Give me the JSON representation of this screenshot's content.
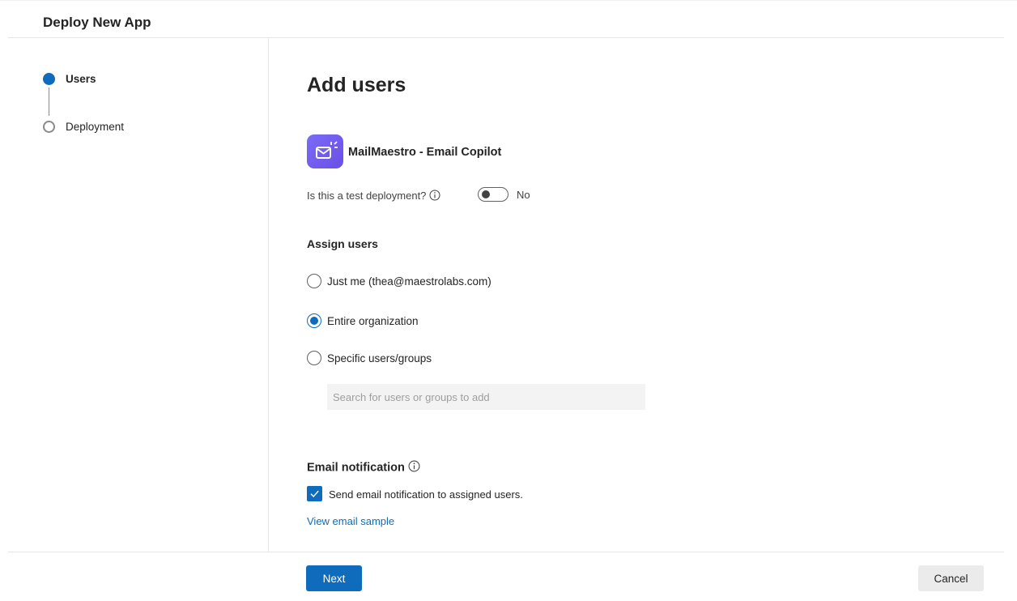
{
  "header": {
    "title": "Deploy New App"
  },
  "steps": [
    {
      "label": "Users",
      "state": "active"
    },
    {
      "label": "Deployment",
      "state": "inactive"
    }
  ],
  "main": {
    "title": "Add users",
    "app": {
      "name": "MailMaestro - Email Copilot",
      "icon": "mail-sparkle-icon",
      "icon_color": "#7b6cf6"
    },
    "test_deployment": {
      "label": "Is this a test deployment?",
      "toggle_value": "No",
      "enabled": false
    },
    "assign_users": {
      "title": "Assign users",
      "options": [
        {
          "label": "Just me (thea@maestrolabs.com)",
          "selected": false
        },
        {
          "label": "Entire organization",
          "selected": true
        },
        {
          "label": "Specific users/groups",
          "selected": false
        }
      ],
      "search_placeholder": "Search for users or groups to add"
    },
    "email_notification": {
      "title": "Email notification",
      "checkbox_label": "Send email notification to assigned users.",
      "checked": true,
      "link": "View email sample"
    }
  },
  "footer": {
    "next_label": "Next",
    "cancel_label": "Cancel"
  },
  "colors": {
    "accent": "#0f6cbd",
    "border": "#e6e6e6"
  }
}
